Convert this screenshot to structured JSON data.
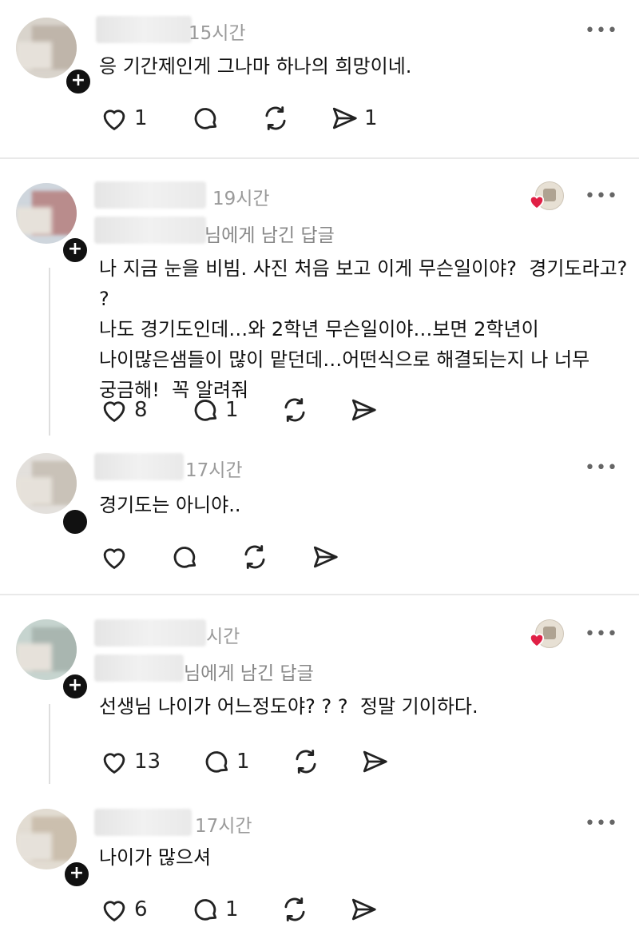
{
  "posts": [
    {
      "time": "15시간",
      "reply_to": "",
      "text": "응 기간제인게 그나마 하나의 희망이네.",
      "actions": {
        "likes": "1",
        "comments": "",
        "reposts": "",
        "shares": "1"
      }
    },
    {
      "time": "19시간",
      "reply_to": "님에게 남긴 답글",
      "text": "나 지금 눈을 비빔. 사진 처음 보고 이게 무슨일이야?  경기도라고? ?\n나도 경기도인데…와 2학년 무슨일이야…보면 2학년이\n나이많은샘들이 많이 맡던데…어떤식으로 해결되는지 나 너무\n궁금해!  꼭 알려줘",
      "actions": {
        "likes": "8",
        "comments": "1",
        "reposts": "",
        "shares": ""
      }
    },
    {
      "time": "17시간",
      "reply_to": "",
      "text": "경기도는 아니야..",
      "actions": {
        "likes": "",
        "comments": "",
        "reposts": "",
        "shares": ""
      }
    },
    {
      "time": "시간",
      "reply_to": "님에게 남긴 답글",
      "text": "선생님 나이가 어느정도야? ? ?  정말 기이하다.",
      "actions": {
        "likes": "13",
        "comments": "1",
        "reposts": "",
        "shares": ""
      }
    },
    {
      "time": "17시간",
      "reply_to": "",
      "text": "나이가 많으셔",
      "actions": {
        "likes": "6",
        "comments": "1",
        "reposts": "",
        "shares": ""
      }
    }
  ],
  "icons": {
    "more": "more-options-icon",
    "like": "heart-icon",
    "comment": "comment-bubble-icon",
    "repost": "repost-icon",
    "share": "send-icon"
  },
  "more_label": "•••",
  "plus_label": "+",
  "colors": {
    "text": "#111111",
    "muted": "#9a9a9a",
    "divider": "#e9e9e9",
    "heart": "#e02045"
  }
}
